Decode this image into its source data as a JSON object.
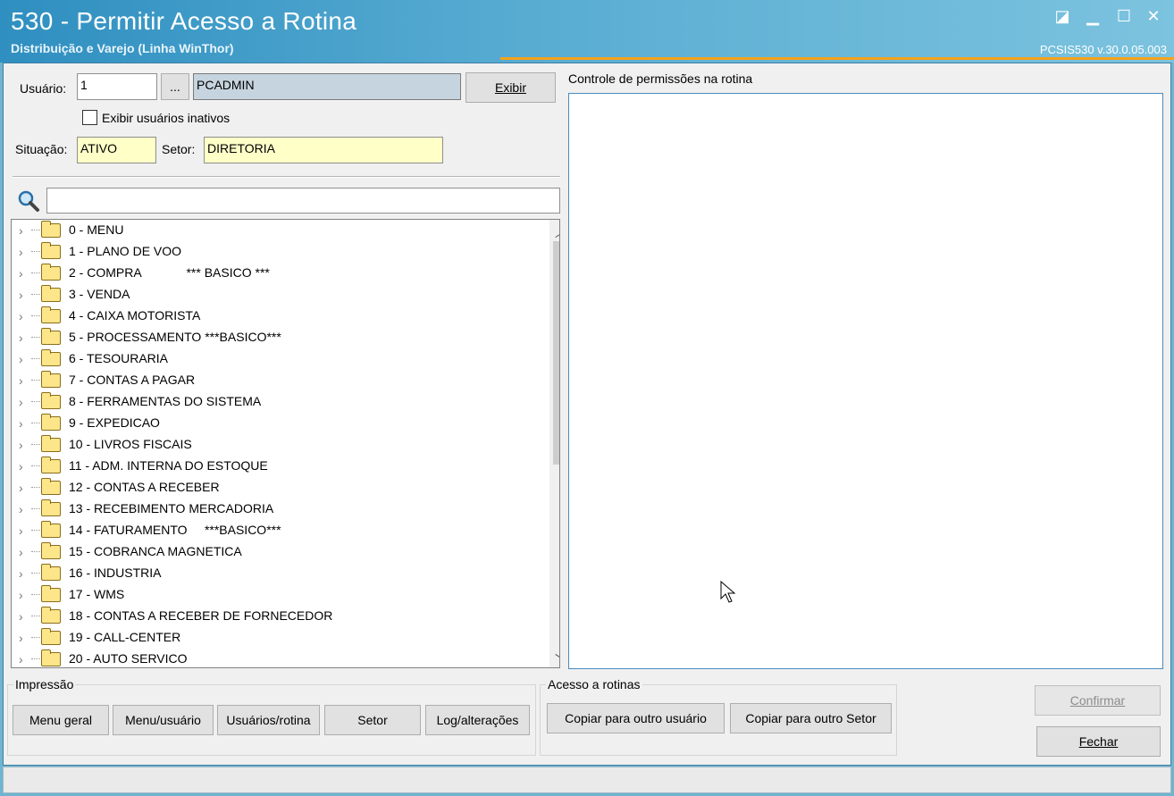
{
  "window": {
    "title": "530 - Permitir Acesso a Rotina",
    "subtitle": "Distribuição e Varejo (Linha WinThor)",
    "version": "PCSIS530  v.30.0.05.003",
    "controls": {
      "restore": "◪",
      "minimize": "▁",
      "maximize": "☐",
      "close": "✕"
    }
  },
  "user_panel": {
    "usuario_label": "Usuário:",
    "usuario_value": "1",
    "browse_label": "...",
    "usuario_name": "PCADMIN",
    "exibir_label": "Exibir",
    "inativos_label": "Exibir usuários inativos",
    "inativos_checked": false,
    "situacao_label": "Situação:",
    "situacao_value": "ATIVO",
    "setor_label": "Setor:",
    "setor_value": "DIRETORIA"
  },
  "search": {
    "value": "",
    "icon": "search-icon"
  },
  "tree": {
    "items": [
      {
        "label": "0 - MENU"
      },
      {
        "label": "1 - PLANO DE VOO"
      },
      {
        "label": "2 - COMPRA             *** BASICO ***"
      },
      {
        "label": "3 - VENDA"
      },
      {
        "label": "4 - CAIXA MOTORISTA"
      },
      {
        "label": "5 - PROCESSAMENTO ***BASICO***"
      },
      {
        "label": "6 - TESOURARIA"
      },
      {
        "label": "7 - CONTAS A PAGAR"
      },
      {
        "label": "8 - FERRAMENTAS DO SISTEMA"
      },
      {
        "label": "9 - EXPEDICAO"
      },
      {
        "label": "10 - LIVROS FISCAIS"
      },
      {
        "label": "11 - ADM. INTERNA DO ESTOQUE"
      },
      {
        "label": "12 - CONTAS A RECEBER"
      },
      {
        "label": "13 - RECEBIMENTO MERCADORIA"
      },
      {
        "label": "14 - FATURAMENTO     ***BASICO***"
      },
      {
        "label": "15 - COBRANCA MAGNETICA"
      },
      {
        "label": "16 - INDUSTRIA"
      },
      {
        "label": "17 - WMS"
      },
      {
        "label": "18 - CONTAS A RECEBER DE FORNECEDOR"
      },
      {
        "label": "19 - CALL-CENTER"
      },
      {
        "label": "20 - AUTO SERVICO"
      }
    ]
  },
  "permissions": {
    "title": "Controle de permissões na rotina"
  },
  "impressao": {
    "title": "Impressão",
    "buttons": [
      "Menu geral",
      "Menu/usuário",
      "Usuários/rotina",
      "Setor",
      "Log/alterações"
    ]
  },
  "acesso": {
    "title": "Acesso a rotinas",
    "buttons": [
      "Copiar para outro usuário",
      "Copiar para outro Setor"
    ]
  },
  "actions": {
    "confirmar": "Confirmar",
    "fechar": "Fechar"
  },
  "colors": {
    "title_gradient_start": "#2f8fc0",
    "title_gradient_end": "#7cc3df",
    "accent_line": "#f4a21a",
    "field_yellow": "#ffffc8"
  }
}
